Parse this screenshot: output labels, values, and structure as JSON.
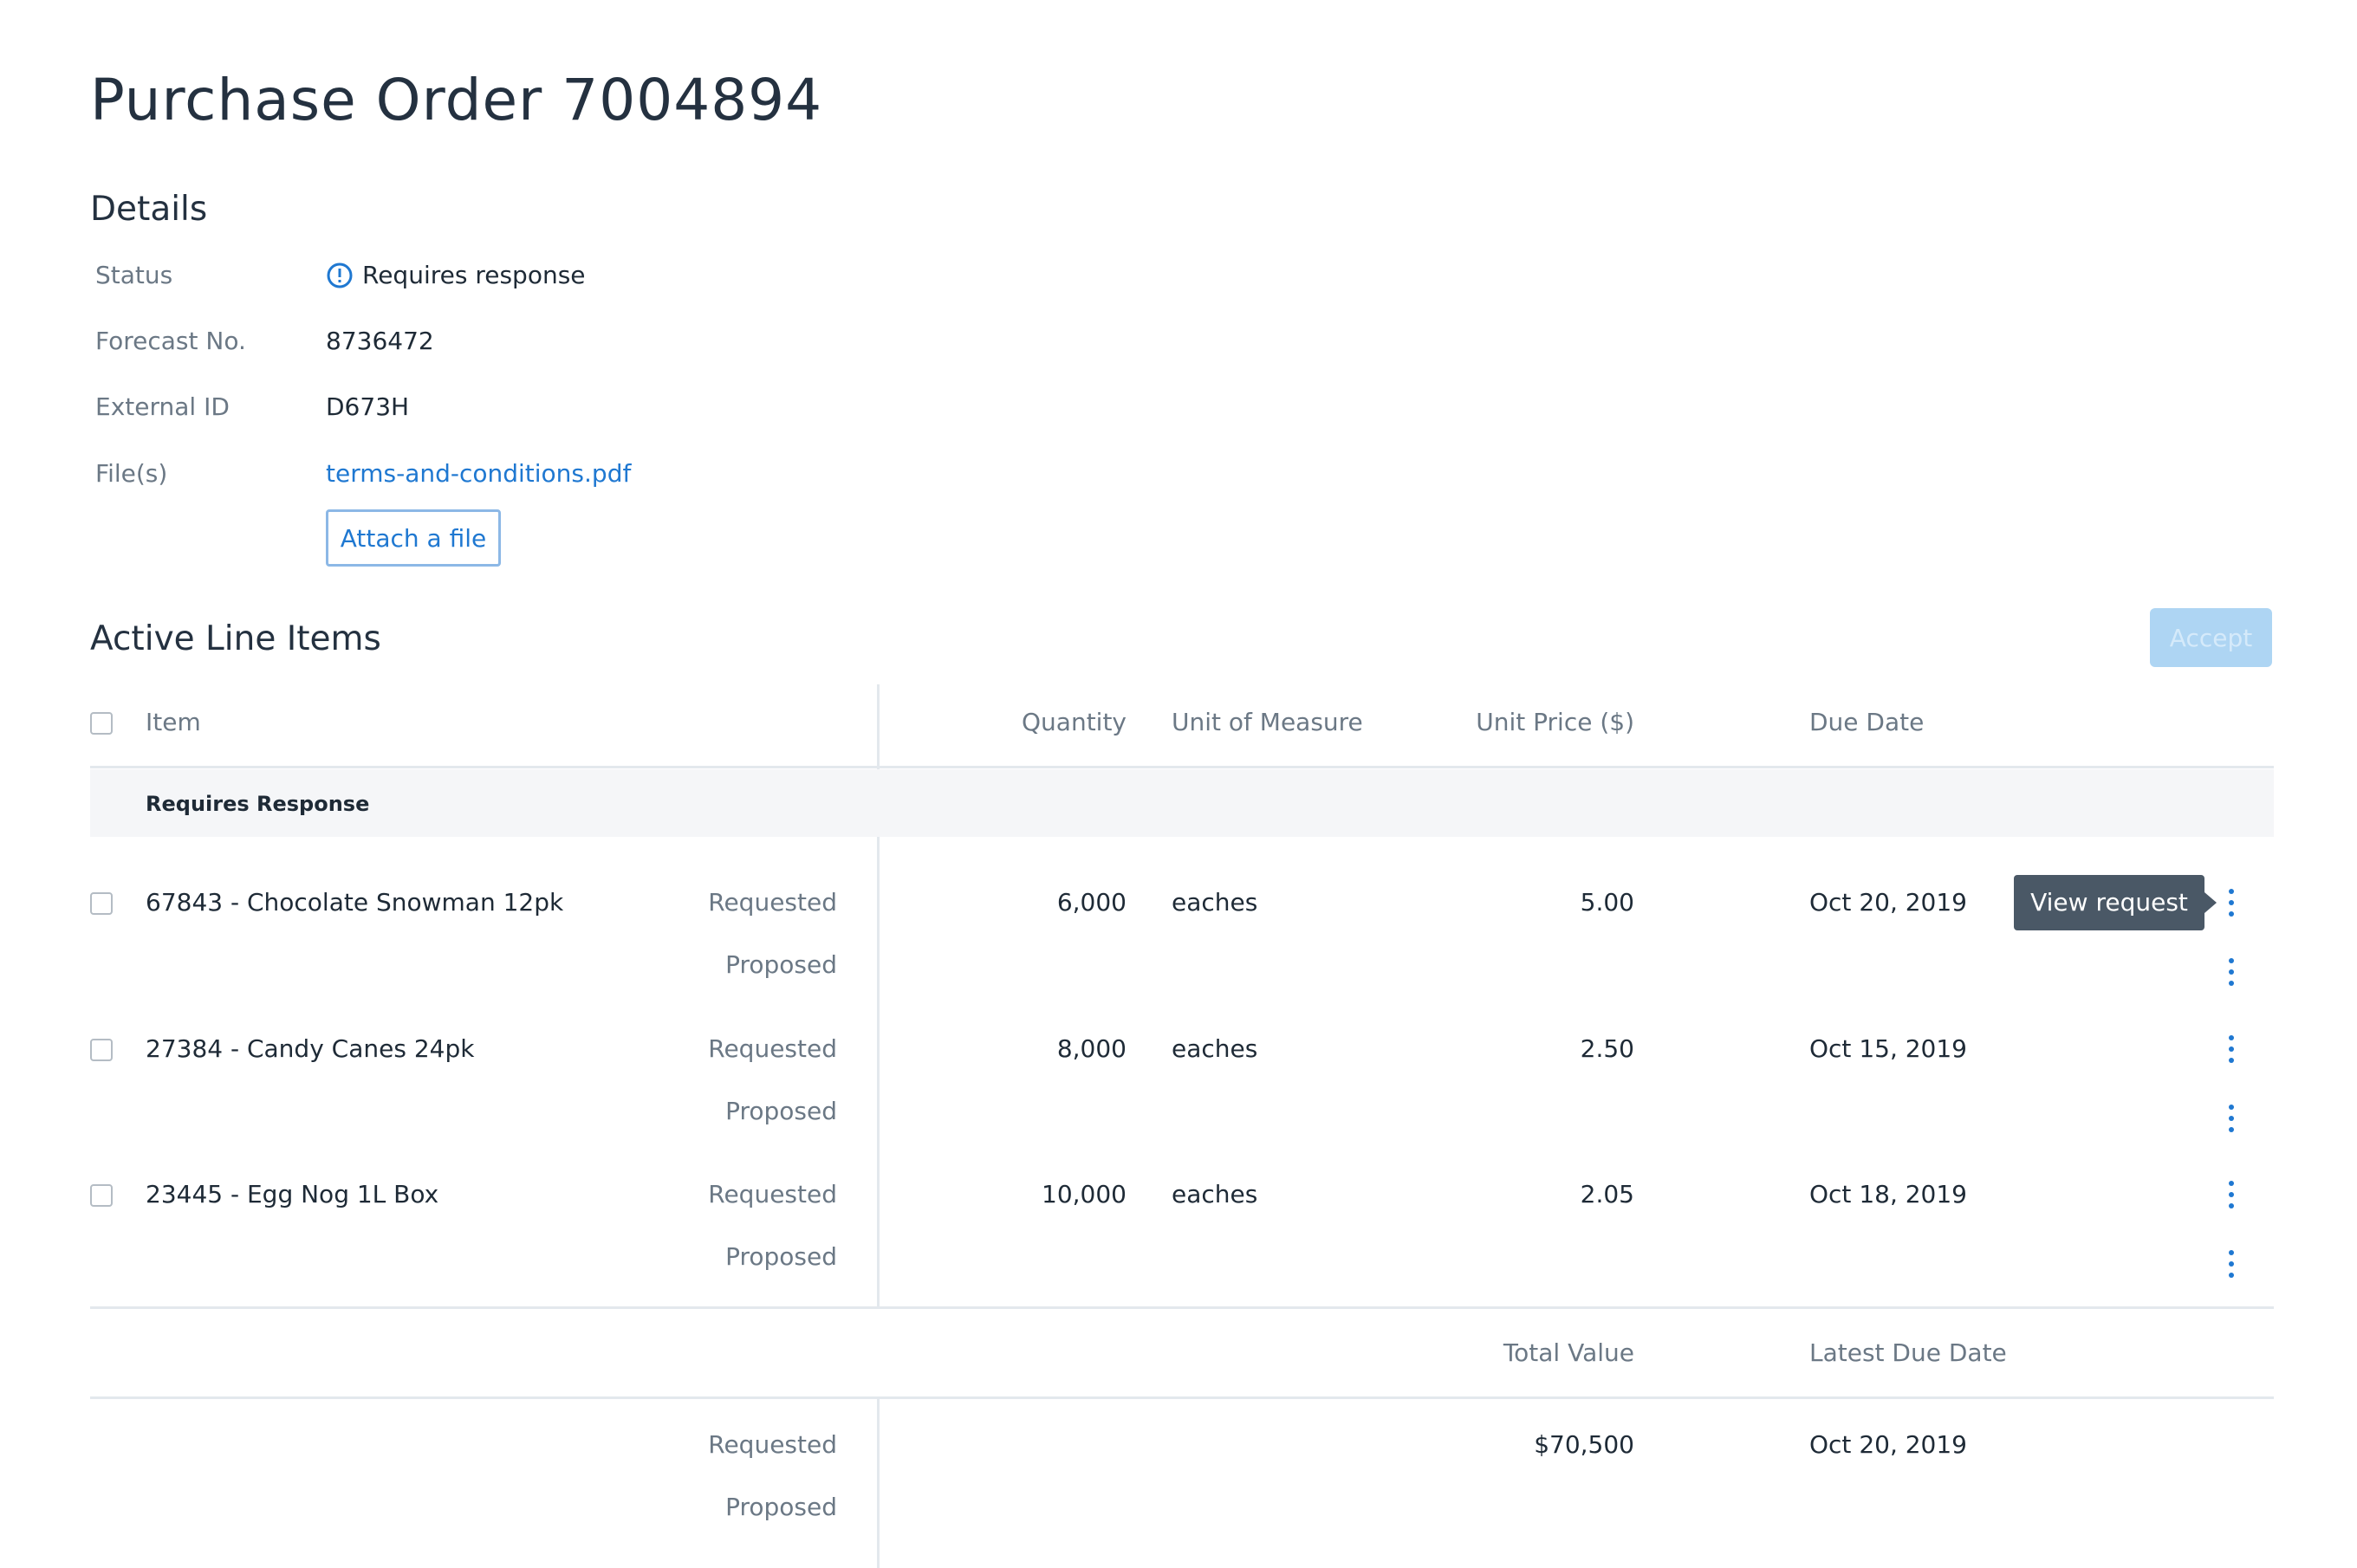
{
  "page": {
    "title": "Purchase Order 7004894"
  },
  "details": {
    "heading": "Details",
    "status": {
      "label": "Status",
      "value": "Requires response"
    },
    "forecast": {
      "label": "Forecast No.",
      "value": "8736472"
    },
    "external_id": {
      "label": "External ID",
      "value": "D673H"
    },
    "files": {
      "label": "File(s)",
      "file_name": "terms-and-conditions.pdf",
      "attach_label": "Attach a file"
    }
  },
  "line_items": {
    "heading": "Active Line Items",
    "accept_label": "Accept",
    "columns": {
      "item": "Item",
      "quantity": "Quantity",
      "unit": "Unit of Measure",
      "unit_price": "Unit Price ($)",
      "due_date": "Due Date"
    },
    "group_label": "Requires Response",
    "requested_label": "Requested",
    "proposed_label": "Proposed",
    "rows": [
      {
        "item": "67843 - Chocolate Snowman 12pk",
        "quantity": "6,000",
        "unit": "eaches",
        "unit_price": "5.00",
        "due_date": "Oct 20, 2019"
      },
      {
        "item": "27384 - Candy Canes 24pk",
        "quantity": "8,000",
        "unit": "eaches",
        "unit_price": "2.50",
        "due_date": "Oct 15, 2019"
      },
      {
        "item": "23445 - Egg Nog 1L Box",
        "quantity": "10,000",
        "unit": "eaches",
        "unit_price": "2.05",
        "due_date": "Oct 18, 2019"
      }
    ],
    "tooltip": "View request"
  },
  "totals": {
    "total_value_label": "Total Value",
    "latest_due_label": "Latest Due Date",
    "requested_label": "Requested",
    "proposed_label": "Proposed",
    "requested_total": "$70,500",
    "requested_due": "Oct 20, 2019"
  },
  "colors": {
    "accent": "#1f78d1",
    "text": "#1e2a36",
    "muted": "#6b7885",
    "accept_disabled": "#aed5f3",
    "tooltip_bg": "#4a5866"
  }
}
